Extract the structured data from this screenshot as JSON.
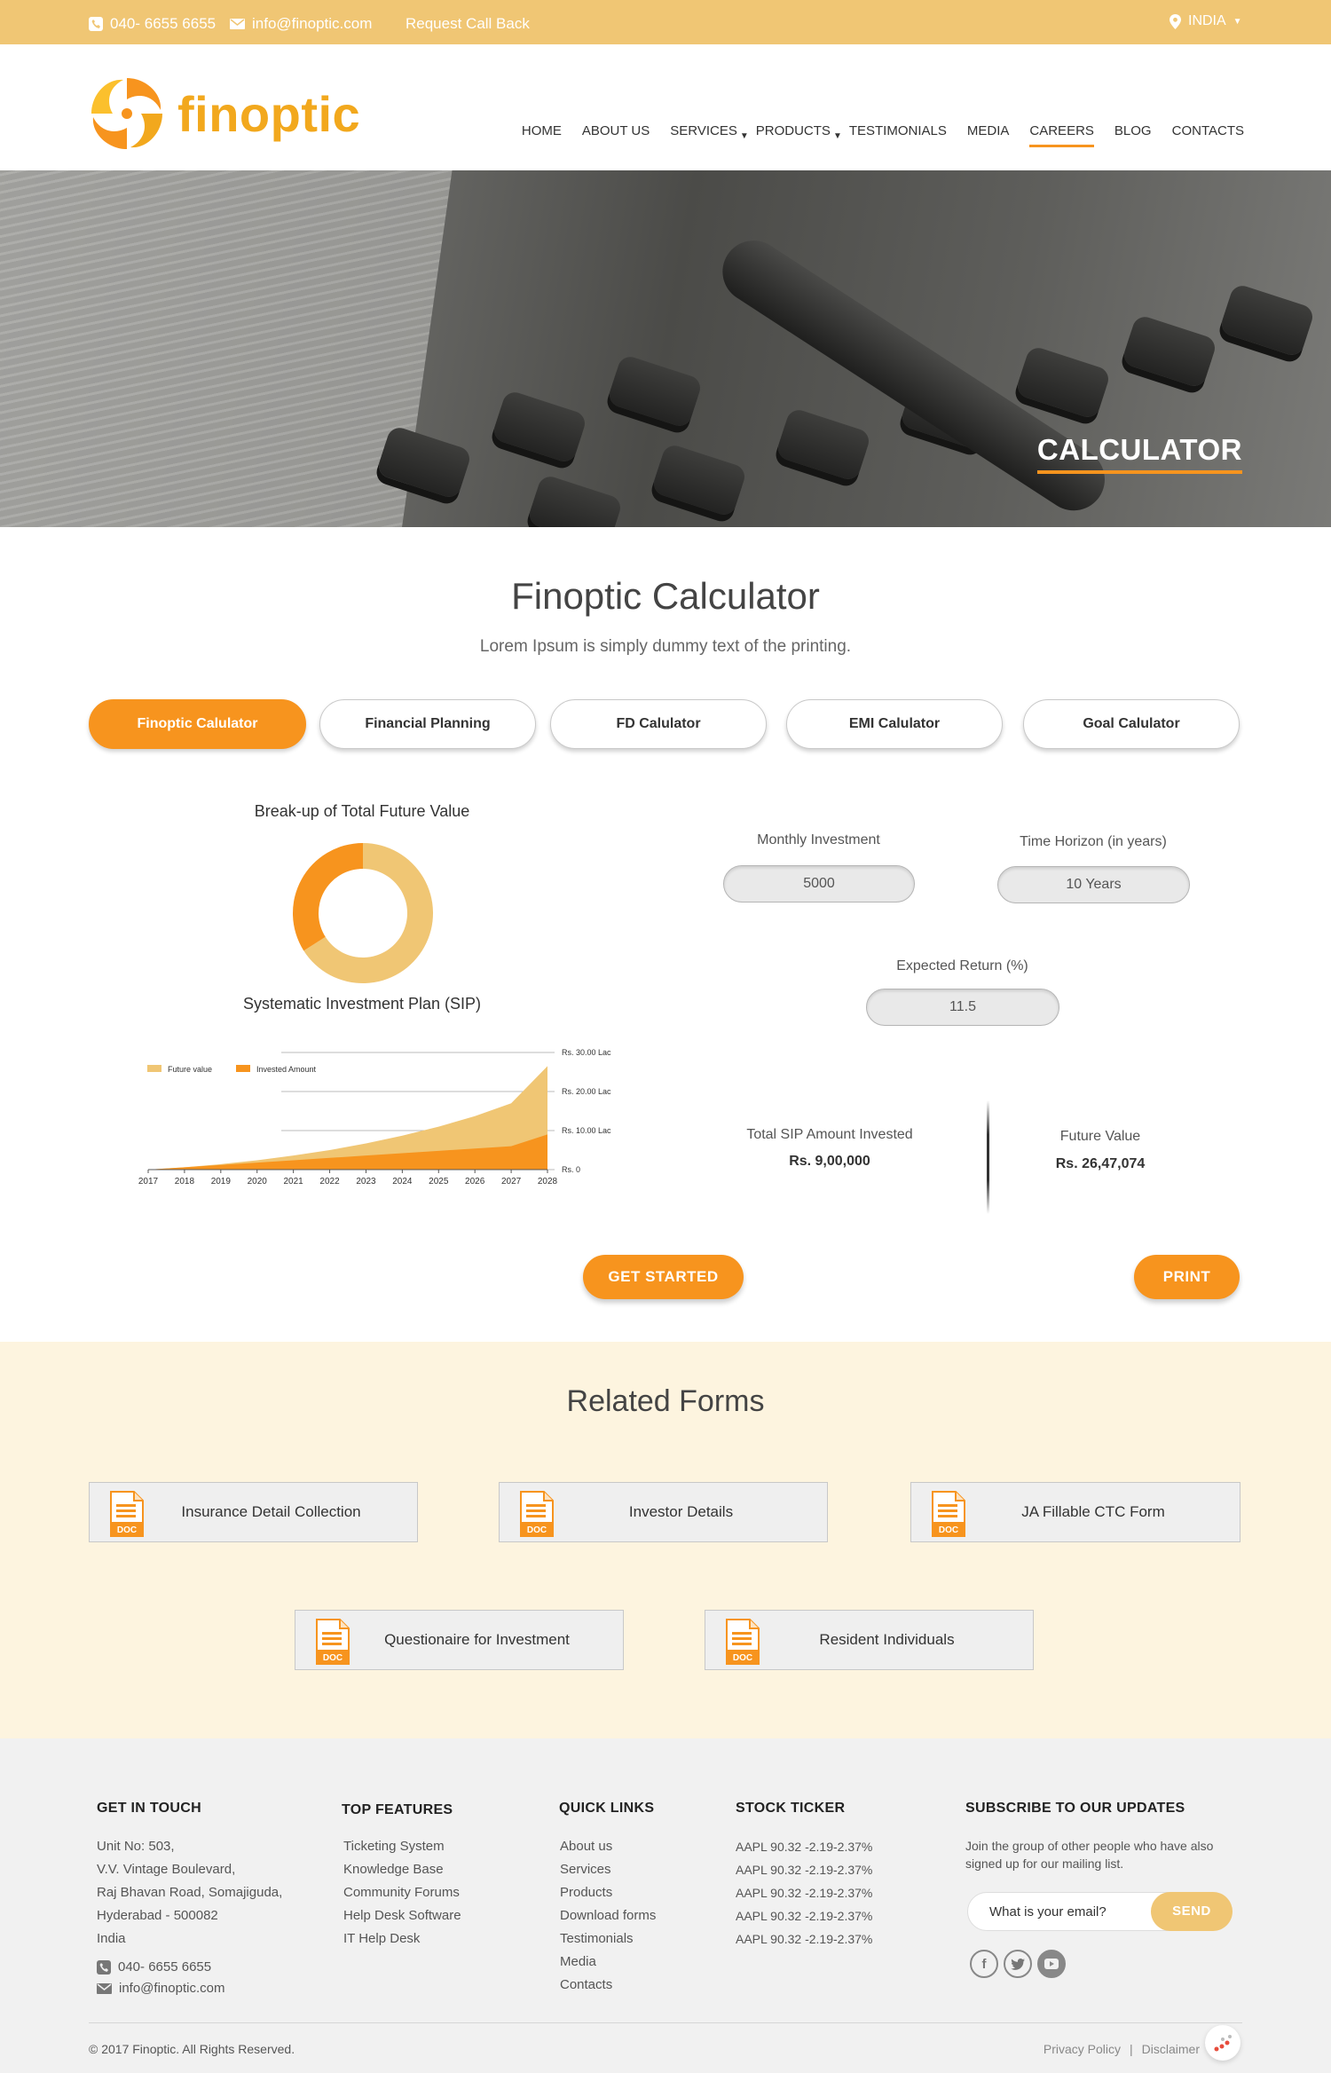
{
  "topbar": {
    "phone": "040- 6655 6655",
    "email": "info@finoptic.com",
    "callback": "Request Call Back",
    "country": "INDIA"
  },
  "brand": {
    "name": "finoptic",
    "accent": "#f7941e",
    "yellow": "#f0c674"
  },
  "nav": [
    {
      "label": "HOME"
    },
    {
      "label": "ABOUT US"
    },
    {
      "label": "SERVICES"
    },
    {
      "label": "PRODUCTS"
    },
    {
      "label": "TESTIMONIALS"
    },
    {
      "label": "MEDIA"
    },
    {
      "label": "CAREERS",
      "active": true
    },
    {
      "label": "BLOG"
    },
    {
      "label": "CONTACTS"
    }
  ],
  "hero": {
    "title": "CALCULATOR"
  },
  "calculator": {
    "title": "Finoptic Calculator",
    "subtitle": "Lorem Ipsum is simply dummy text of the printing.",
    "tabs": [
      "Finoptic Calulator",
      "Financial Planning",
      "FD Calulator",
      "EMI Calulator",
      "Goal Calulator"
    ],
    "active_tab": 0,
    "donut_title": "Break-up of Total Future Value",
    "sip_title": "Systematic Investment Plan (SIP)",
    "fields": {
      "monthly_label": "Monthly Investment",
      "monthly_value": "5000",
      "horizon_label": "Time Horizon (in years)",
      "horizon_value": "10 Years",
      "return_label": "Expected Return (%)",
      "return_value": "11.5"
    },
    "summary": {
      "invested_label": "Total SIP Amount Invested",
      "invested_value": "Rs. 9,00,000",
      "future_label": "Future Value",
      "future_value": "Rs. 26,47,074"
    },
    "get_started": "GET STARTED",
    "print": "PRINT"
  },
  "chart_data": [
    {
      "type": "pie",
      "title": "Break-up of Total Future Value",
      "slices": [
        {
          "value": 66,
          "color": "#f0c674"
        },
        {
          "value": 34,
          "color": "#f7941e"
        }
      ]
    },
    {
      "type": "area",
      "title": "Systematic Investment Plan (SIP)",
      "x": [
        "2017",
        "2018",
        "2019",
        "2020",
        "2021",
        "2022",
        "2023",
        "2024",
        "2025",
        "2026",
        "2027",
        "2028"
      ],
      "yticks": [
        "Rs. 0",
        "Rs. 10.00 Lac",
        "Rs. 20.00 Lac",
        "Rs. 30.00 Lac"
      ],
      "ylim": [
        0,
        30
      ],
      "legend_position": "top-left",
      "series": [
        {
          "name": "Future value",
          "color": "#f0c674",
          "values": [
            0,
            0.6,
            1.4,
            2.4,
            3.6,
            5.0,
            6.7,
            8.7,
            11.0,
            13.7,
            17.0,
            26.5
          ]
        },
        {
          "name": "Invested Amount",
          "color": "#f7941e",
          "values": [
            0,
            0.6,
            1.2,
            1.8,
            2.4,
            3.0,
            3.6,
            4.2,
            4.8,
            5.4,
            6.0,
            9.0
          ]
        }
      ]
    }
  ],
  "related": {
    "title": "Related Forms",
    "doc_badge": "DOC",
    "forms": [
      "Insurance Detail Collection",
      "Investor Details",
      "JA Fillable CTC Form",
      "Questionaire for Investment",
      "Resident Individuals"
    ]
  },
  "footer": {
    "touch_title": "GET IN TOUCH",
    "address": [
      "Unit No: 503,",
      "V.V. Vintage Boulevard,",
      "Raj Bhavan Road, Somajiguda,",
      "Hyderabad - 500082",
      "India"
    ],
    "phone": "040- 6655 6655",
    "email": "info@finoptic.com",
    "features_title": "TOP FEATURES",
    "features": [
      "Ticketing System",
      "Knowledge Base",
      "Community Forums",
      "Help Desk Software",
      "IT Help Desk"
    ],
    "links_title": "QUICK LINKS",
    "links": [
      "About us",
      "Services",
      "Products",
      "Download forms",
      "Testimonials",
      "Media",
      "Contacts"
    ],
    "ticker_title": "STOCK TICKER",
    "ticker": [
      "AAPL 90.32 -2.19-2.37%",
      "AAPL 90.32 -2.19-2.37%",
      "AAPL 90.32 -2.19-2.37%",
      "AAPL 90.32 -2.19-2.37%",
      "AAPL 90.32 -2.19-2.37%"
    ],
    "subscribe_title": "SUBSCRIBE TO OUR UPDATES",
    "subscribe_text": "Join the group of other people who have also signed up for our mailing list.",
    "email_placeholder": "What is your email?",
    "send": "SEND",
    "social": [
      "facebook-icon",
      "twitter-icon",
      "youtube-icon"
    ],
    "copyright": "© 2017 Finoptic. All Rights Reserved.",
    "privacy": "Privacy Policy",
    "sep": "|",
    "disclaimer": "Disclaimer"
  }
}
